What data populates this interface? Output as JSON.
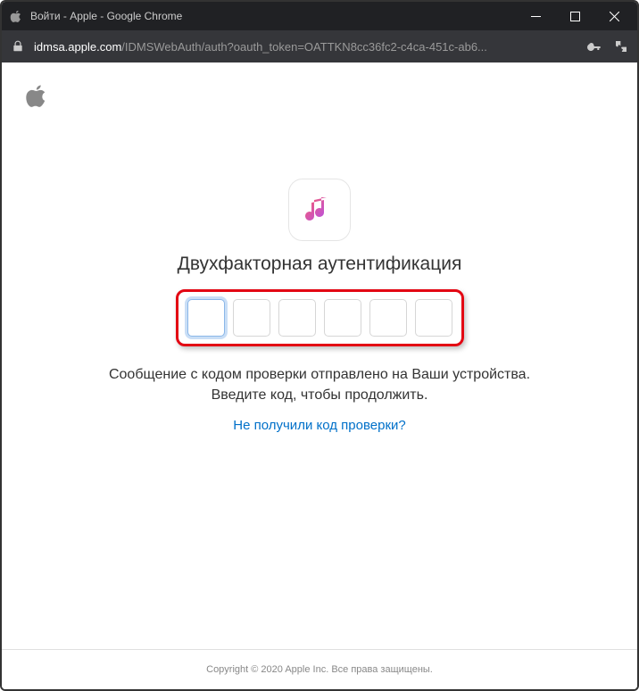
{
  "window": {
    "title": "Войти - Apple - Google Chrome"
  },
  "addressbar": {
    "domain": "idmsa.apple.com",
    "path": "/IDMSWebAuth/auth?oauth_token=OATTKN8cc36fc2-c4ca-451c-ab6..."
  },
  "page": {
    "heading": "Двухфакторная аутентификация",
    "description": "Сообщение с кодом проверки отправлено на Ваши устройства. Введите код, чтобы продолжить.",
    "help_link": "Не получили код проверки?",
    "footer": "Copyright © 2020 Apple Inc. Все права защищены."
  },
  "code": {
    "digits": [
      "",
      "",
      "",
      "",
      "",
      ""
    ]
  }
}
